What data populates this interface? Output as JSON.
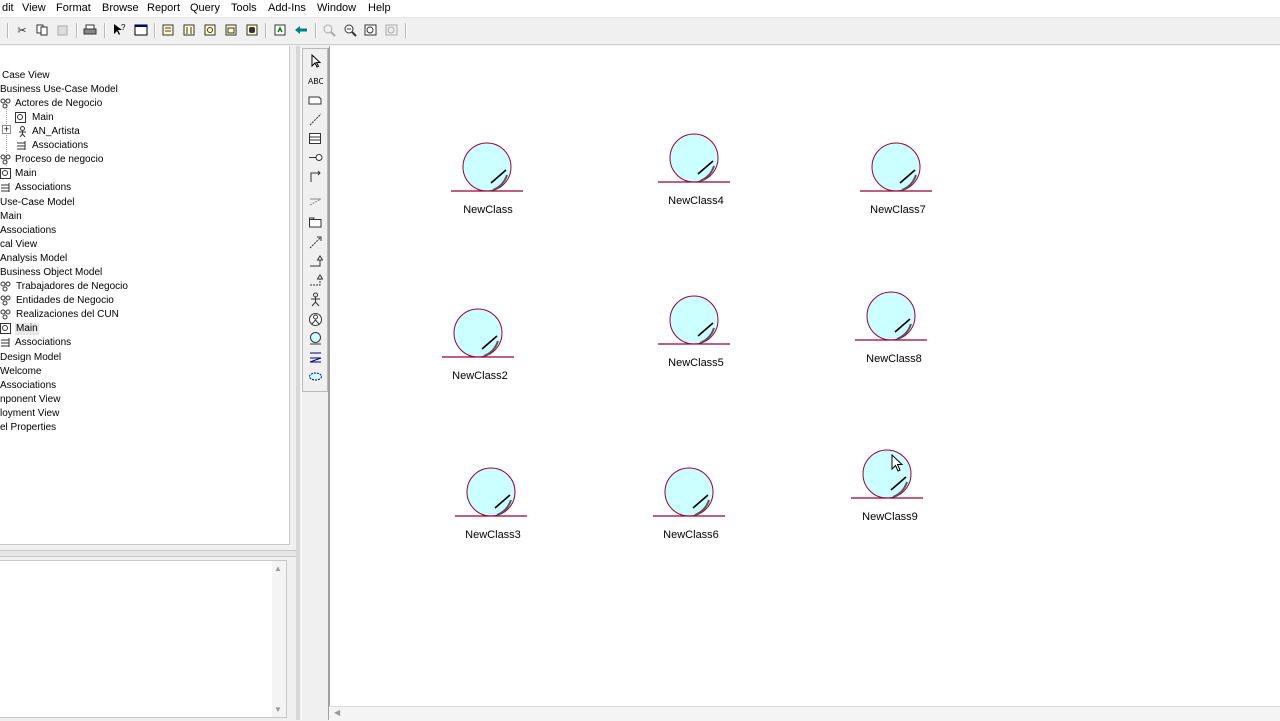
{
  "menubar": {
    "items": [
      "dit",
      "View",
      "Format",
      "Browse",
      "Report",
      "Query",
      "Tools",
      "Add-Ins",
      "Window",
      "Help"
    ]
  },
  "toolbar": {
    "buttons": [
      "cut-icon",
      "copy-icon",
      "paste-icon",
      "print-icon",
      "context-help-icon",
      "view-doc-icon",
      "browse-class-icon",
      "browse-interaction-icon",
      "browse-component-icon",
      "browse-deployment-icon",
      "browse-state-icon",
      "browse-parent-icon",
      "browse-previous-icon",
      "zoom-in-icon",
      "zoom-out-icon",
      "fit-window-icon",
      "undo-fit-icon"
    ]
  },
  "tree": {
    "items": [
      {
        "label": "",
        "indent": 0
      },
      {
        "label": "Case View",
        "indent": 0
      },
      {
        "label": "Business Use-Case Model",
        "indent": 0
      },
      {
        "label": "Actores de Negocio",
        "indent": 1
      },
      {
        "label": "Main",
        "indent": 2
      },
      {
        "label": "AN_Artista",
        "indent": 2
      },
      {
        "label": "Associations",
        "indent": 2
      },
      {
        "label": "Proceso de negocio",
        "indent": 1
      },
      {
        "label": "Main",
        "indent": 1
      },
      {
        "label": "Associations",
        "indent": 1
      },
      {
        "label": "Use-Case Model",
        "indent": 0
      },
      {
        "label": "Main",
        "indent": 0
      },
      {
        "label": "Associations",
        "indent": 0
      },
      {
        "label": "cal View",
        "indent": 0
      },
      {
        "label": "Analysis Model",
        "indent": 0
      },
      {
        "label": "Business Object Model",
        "indent": 0
      },
      {
        "label": "Trabajadores de Negocio",
        "indent": 1
      },
      {
        "label": "Entidades de Negocio",
        "indent": 1
      },
      {
        "label": "Realizaciones del CUN",
        "indent": 1
      },
      {
        "label": "Main",
        "indent": 1
      },
      {
        "label": "Associations",
        "indent": 1
      },
      {
        "label": "Design Model",
        "indent": 0
      },
      {
        "label": "Welcome",
        "indent": 0
      },
      {
        "label": "Associations",
        "indent": 0
      },
      {
        "label": "nponent View",
        "indent": 0
      },
      {
        "label": "loyment View",
        "indent": 0
      },
      {
        "label": "el Properties",
        "indent": 0
      }
    ]
  },
  "toolbox": {
    "tools": [
      "selection-arrow-icon",
      "text-box-icon",
      "note-icon",
      "anchor-note-icon",
      "class-icon",
      "interface-icon",
      "unidirectional-association-icon",
      "association-class-icon",
      "package-icon",
      "dependency-icon",
      "generalization-icon",
      "realize-icon",
      "business-actor-icon",
      "business-worker-icon",
      "business-entity-icon",
      "business-event-icon",
      "business-use-case-realization-icon"
    ]
  },
  "diagram": {
    "entities": [
      {
        "name": "NewClass"
      },
      {
        "name": "NewClass4"
      },
      {
        "name": "NewClass7"
      },
      {
        "name": "NewClass2"
      },
      {
        "name": "NewClass5"
      },
      {
        "name": "NewClass8"
      },
      {
        "name": "NewClass3"
      },
      {
        "name": "NewClass6"
      },
      {
        "name": "NewClass9"
      }
    ],
    "colors": {
      "entity_fill": "#ccffff",
      "entity_line": "#990033",
      "entity_stroke": "#000000"
    }
  }
}
